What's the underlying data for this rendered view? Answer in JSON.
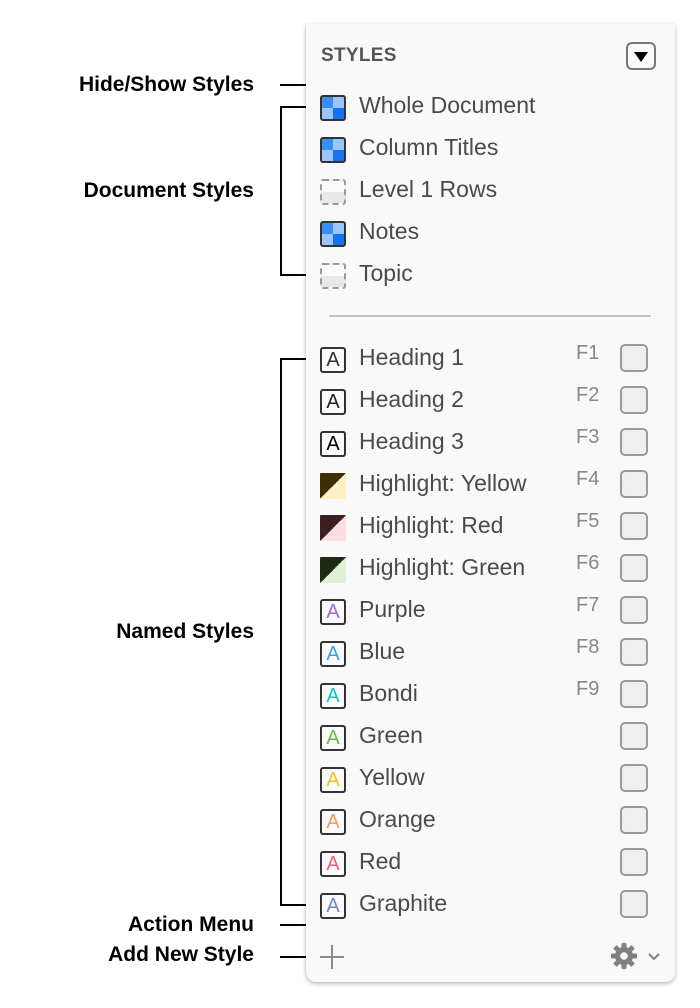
{
  "callouts": {
    "hide_show": "Hide/Show Styles",
    "document_styles": "Document Styles",
    "named_styles": "Named Styles",
    "action_menu": "Action Menu",
    "add_new_style": "Add New Style"
  },
  "panel": {
    "title": "STYLES",
    "toggle_icon": "triangle-down-icon",
    "document_styles": [
      {
        "label": "Whole Document",
        "icon": "blue-checker-icon"
      },
      {
        "label": "Column Titles",
        "icon": "blue-checker-icon"
      },
      {
        "label": "Level 1 Rows",
        "icon": "empty-dashed-icon"
      },
      {
        "label": "Notes",
        "icon": "blue-checker-icon"
      },
      {
        "label": "Topic",
        "icon": "empty-dashed-icon"
      }
    ],
    "named_styles": [
      {
        "label": "Heading 1",
        "key": "F1",
        "icon": "letter-a-icon",
        "color": "#333333",
        "checked": false
      },
      {
        "label": "Heading 2",
        "key": "F2",
        "icon": "letter-a-icon",
        "color": "#222222",
        "checked": false
      },
      {
        "label": "Heading 3",
        "key": "F3",
        "icon": "letter-a-icon",
        "color": "#000000",
        "checked": false
      },
      {
        "label": "Highlight: Yellow",
        "key": "F4",
        "icon": "highlight-swatch-icon",
        "color": "#3d2e05",
        "color2": "#fdefc2",
        "checked": false
      },
      {
        "label": "Highlight: Red",
        "key": "F5",
        "icon": "highlight-swatch-icon",
        "color": "#3d1c22",
        "color2": "#fddde2",
        "checked": false
      },
      {
        "label": "Highlight: Green",
        "key": "F6",
        "icon": "highlight-swatch-icon",
        "color": "#1e2a14",
        "color2": "#e0f0d6",
        "checked": false
      },
      {
        "label": "Purple",
        "key": "F7",
        "icon": "letter-a-icon",
        "color": "#a56ad8",
        "checked": false
      },
      {
        "label": "Blue",
        "key": "F8",
        "icon": "letter-a-icon",
        "color": "#3f9cf4",
        "checked": false
      },
      {
        "label": "Bondi",
        "key": "F9",
        "icon": "letter-a-icon",
        "color": "#17c2c5",
        "checked": false
      },
      {
        "label": "Green",
        "key": "",
        "icon": "letter-a-icon",
        "color": "#62bd3c",
        "checked": false
      },
      {
        "label": "Yellow",
        "key": "",
        "icon": "letter-a-icon",
        "color": "#f8c21c",
        "checked": false
      },
      {
        "label": "Orange",
        "key": "",
        "icon": "letter-a-icon",
        "color": "#f7985b",
        "checked": false
      },
      {
        "label": "Red",
        "key": "",
        "icon": "letter-a-icon",
        "color": "#f45d72",
        "checked": false
      },
      {
        "label": "Graphite",
        "key": "",
        "icon": "letter-a-icon",
        "color": "#6d8bbd",
        "checked": false
      }
    ],
    "footer": {
      "add_icon": "plus-icon",
      "action_icon": "gear-icon"
    },
    "swatch_letter": "A"
  }
}
